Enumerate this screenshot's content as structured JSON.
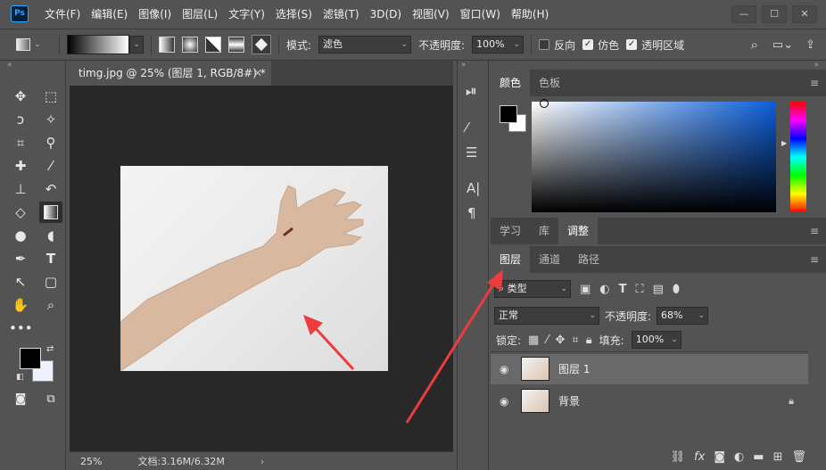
{
  "menubar": {
    "logo": "Ps",
    "items": [
      "文件(F)",
      "编辑(E)",
      "图像(I)",
      "图层(L)",
      "文字(Y)",
      "选择(S)",
      "滤镜(T)",
      "3D(D)",
      "视图(V)",
      "窗口(W)",
      "帮助(H)"
    ],
    "window_buttons": [
      "—",
      "☐",
      "✕"
    ]
  },
  "options": {
    "mode_label": "模式:",
    "mode_value": "滤色",
    "opacity_label": "不透明度:",
    "opacity_value": "100%",
    "reverse_label": "反向",
    "dither_label": "仿色",
    "transparency_label": "透明区域",
    "reverse_checked": false,
    "dither_checked": true,
    "transparency_checked": true
  },
  "document": {
    "tab_title": "timg.jpg @ 25% (图层 1, RGB/8#) *",
    "zoom": "25%",
    "doc_info": "文档:3.16M/6.32M"
  },
  "color_panel": {
    "tabs": [
      "颜色",
      "色板"
    ],
    "colors": {
      "foreground": "#000000",
      "background": "#ffffff"
    }
  },
  "adjust_panel": {
    "tabs": [
      "学习",
      "库",
      "调整"
    ]
  },
  "layers_panel": {
    "tabs": [
      "图层",
      "通道",
      "路径"
    ],
    "filter_label": "类型",
    "blend_mode": "正常",
    "opacity_label": "不透明度:",
    "opacity_value": "68%",
    "lock_label": "锁定:",
    "fill_label": "填充:",
    "fill_value": "100%",
    "layers": [
      {
        "name": "图层 1",
        "selected": true,
        "locked": false
      },
      {
        "name": "背景",
        "selected": false,
        "locked": true
      }
    ]
  },
  "icons": {
    "tools": [
      "move-icon",
      "marquee-icon",
      "lasso-icon",
      "magic-wand-icon",
      "crop-icon",
      "eyedropper-icon",
      "healing-icon",
      "brush-icon",
      "stamp-icon",
      "history-brush-icon",
      "eraser-icon",
      "gradient-icon",
      "blur-icon",
      "dodge-icon",
      "pen-icon",
      "type-icon",
      "path-select-icon",
      "shape-icon",
      "hand-icon",
      "zoom-icon",
      "more-icon"
    ]
  }
}
